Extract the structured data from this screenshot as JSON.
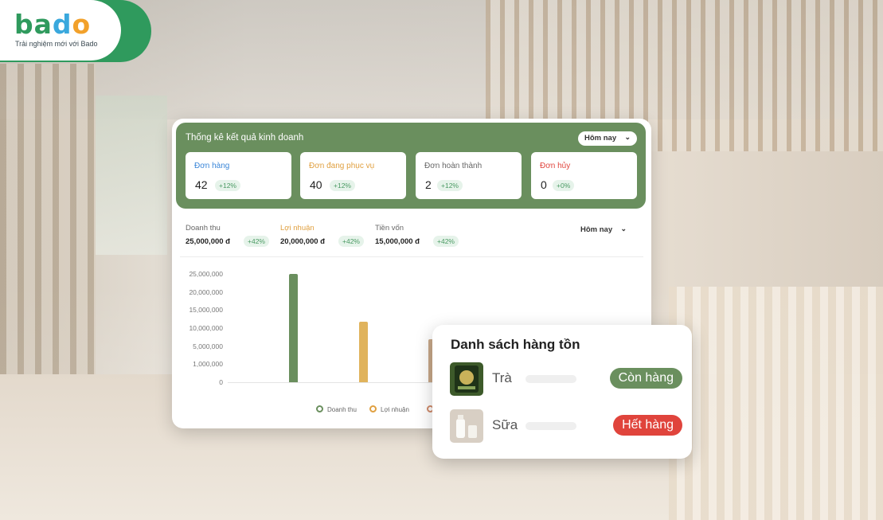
{
  "brand": {
    "logo_letters": [
      "b",
      "a",
      "d",
      "o"
    ],
    "tagline": "Trải nghiệm mới với Bado",
    "colors": {
      "green": "#2f9a5d",
      "blue": "#3aa8dd",
      "orange": "#f2a12b"
    }
  },
  "stats_panel": {
    "title": "Thống kê kết quả kinh doanh",
    "period": "Hôm nay",
    "cards": [
      {
        "label": "Đơn hàng",
        "value": "42",
        "change": "+12%",
        "label_color": "#3a86d8"
      },
      {
        "label": "Đơn đang phục vụ",
        "value": "40",
        "change": "+12%",
        "label_color": "#e0a040"
      },
      {
        "label": "Đơn hoàn thành",
        "value": "2",
        "change": "+12%",
        "label_color": "#666666"
      },
      {
        "label": "Đơn hủy",
        "value": "0",
        "change": "+0%",
        "label_color": "#e0443c"
      }
    ]
  },
  "finance": {
    "period": "Hôm nay",
    "metrics": [
      {
        "label": "Doanh thu",
        "value": "25,000,000 đ",
        "change": "+42%",
        "label_color": "#666666"
      },
      {
        "label": "Lợi nhuận",
        "value": "20,000,000 đ",
        "change": "+42%",
        "label_color": "#e0a040"
      },
      {
        "label": "Tiền vốn",
        "value": "15,000,000 đ",
        "change": "+42%",
        "label_color": "#666666"
      }
    ]
  },
  "chart_data": {
    "type": "bar",
    "title": "",
    "y_ticks": [
      "25,000,000",
      "20,000,000",
      "15,000,000",
      "10,000,000",
      "5,000,000",
      "1,000,000",
      "0"
    ],
    "series": [
      {
        "name": "Doanh thu",
        "value": 25000000,
        "color": "#6a8f5e"
      },
      {
        "name": "Lợi nhuận",
        "value": 14000000,
        "color": "#e0b35c"
      },
      {
        "name": "Tiền vốn",
        "value": 10000000,
        "color": "#c9a98a"
      }
    ],
    "legend": [
      {
        "label": "Doanh thu",
        "color": "#6a8f5e"
      },
      {
        "label": "Lợi nhuận",
        "color": "#e0a040"
      },
      {
        "label": "T",
        "color": "#d08a6a"
      }
    ],
    "ylim": [
      0,
      25000000
    ]
  },
  "inventory": {
    "title": "Danh sách hàng tồn",
    "items": [
      {
        "name": "Trà",
        "status": "Còn hàng",
        "status_color": "#6a8f5e",
        "image_icon": "tea-package-icon"
      },
      {
        "name": "Sữa",
        "status": "Hết hàng",
        "status_color": "#e0443c",
        "image_icon": "milk-bottle-icon"
      }
    ]
  }
}
